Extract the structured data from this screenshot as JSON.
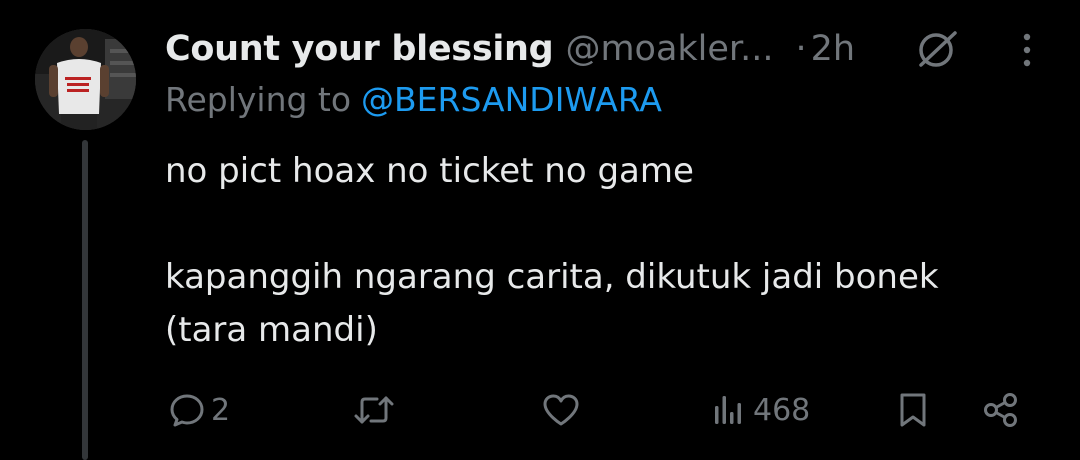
{
  "tweet": {
    "display_name": "Count your blessing",
    "handle": "@moakler...",
    "separator": "·",
    "time": "2h",
    "replying_to_prefix": "Replying to",
    "replying_to_handle": "@BERSANDIWARA",
    "body": "no pict hoax no ticket no game\n\nkapanggih ngarang carita, dikutuk jadi bonek\n(tara mandi)"
  },
  "actions": {
    "reply_count": "2",
    "retweet_count": "",
    "like_count": "",
    "view_count": "468"
  },
  "colors": {
    "background": "#000000",
    "text_primary": "#e7e9ea",
    "text_secondary": "#71767b",
    "accent": "#1d9bf0",
    "thread_line": "#333639"
  },
  "icons": {
    "reply": "reply-icon",
    "retweet": "retweet-icon",
    "like": "heart-icon",
    "views": "views-icon",
    "bookmark": "bookmark-icon",
    "share": "share-icon",
    "grok": "grok-icon",
    "more": "more-icon"
  }
}
